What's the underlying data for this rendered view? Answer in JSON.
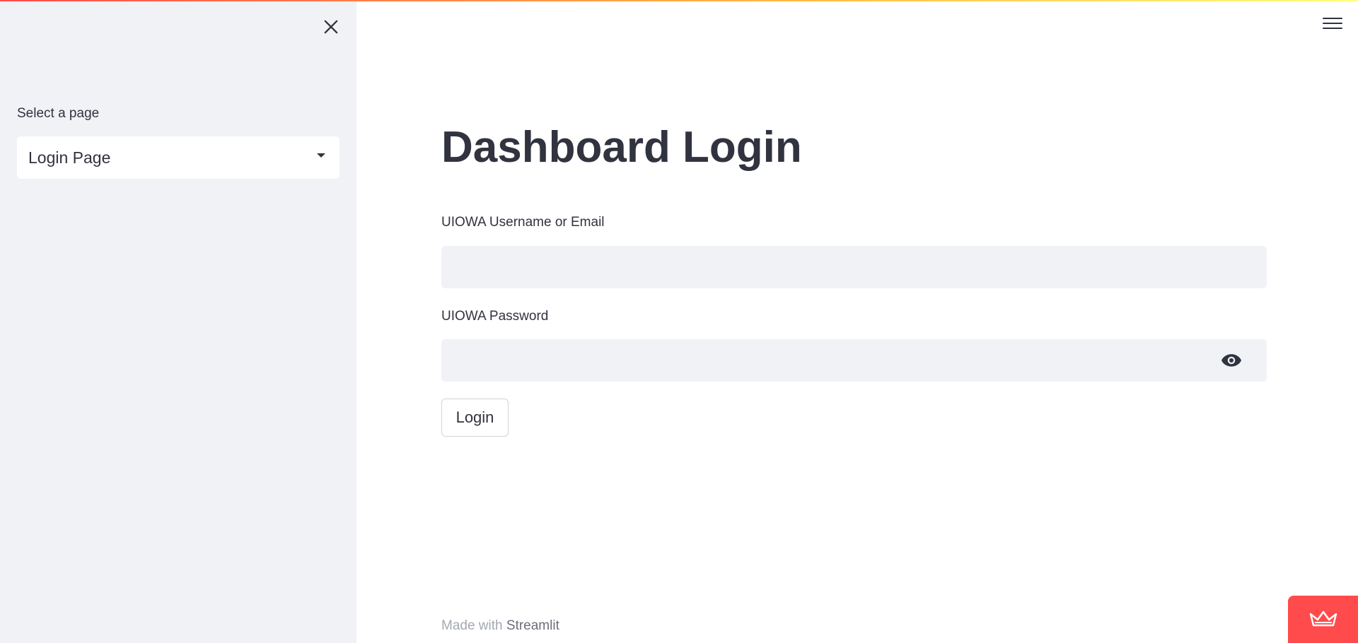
{
  "sidebar": {
    "select_label": "Select a page",
    "selected_page": "Login Page",
    "close_icon": "close-icon"
  },
  "header": {
    "menu_icon": "hamburger-menu-icon",
    "accent_gradient": [
      "#ff4b4b",
      "#ffbd45",
      "#fffd80"
    ]
  },
  "main": {
    "title": "Dashboard Login",
    "username": {
      "label": "UIOWA Username or Email",
      "value": ""
    },
    "password": {
      "label": "UIOWA Password",
      "value": "",
      "toggle_icon": "eye-icon"
    },
    "login_label": "Login"
  },
  "footer": {
    "prefix": "Made with",
    "link": "Streamlit"
  },
  "colors": {
    "sidebar_bg": "#f0f2f6",
    "text": "#31333f",
    "input_bg": "#f0f2f6",
    "badge": "#ff4b4b"
  }
}
